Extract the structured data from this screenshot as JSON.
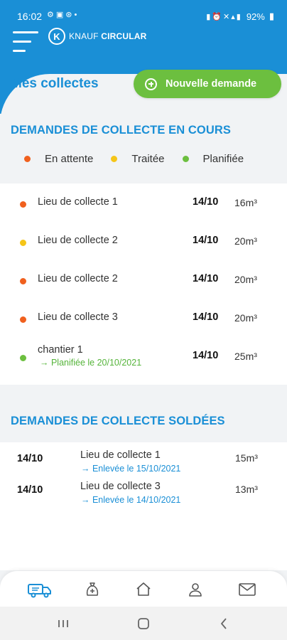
{
  "status_bar": {
    "time": "16:02",
    "battery": "92%"
  },
  "app": {
    "logo_prefix": "KNAUF",
    "logo_suffix": "CIRCULAR"
  },
  "page": {
    "title": "Mes collectes",
    "new_request_label": "Nouvelle demande"
  },
  "pending": {
    "title": "DEMANDES DE COLLECTE EN COURS",
    "legend": [
      {
        "label": "En attente",
        "color": "#f0601e"
      },
      {
        "label": "Traitée",
        "color": "#f5c518"
      },
      {
        "label": "Planifiée",
        "color": "#6cbf3f"
      }
    ],
    "items": [
      {
        "name": "Lieu de collecte 1",
        "date": "14/10",
        "volume": "16m³",
        "status_color": "#f0601e"
      },
      {
        "name": "Lieu de collecte 2",
        "date": "14/10",
        "volume": "20m³",
        "status_color": "#f5c518"
      },
      {
        "name": "Lieu de collecte 2",
        "date": "14/10",
        "volume": "20m³",
        "status_color": "#f0601e"
      },
      {
        "name": "Lieu de collecte 3",
        "date": "14/10",
        "volume": "20m³",
        "status_color": "#f0601e"
      },
      {
        "name": "chantier 1",
        "date": "14/10",
        "volume": "25m³",
        "status_color": "#6cbf3f",
        "sub": "→  Planifiée le 20/10/2021"
      }
    ]
  },
  "closed": {
    "title": "DEMANDES DE COLLECTE SOLDÉES",
    "items": [
      {
        "date": "14/10",
        "name": "Lieu de collecte 1",
        "volume": "15m³",
        "sub": "→  Enlevée le 15/10/2021"
      },
      {
        "date": "14/10",
        "name": "Lieu de collecte 3",
        "volume": "13m³",
        "sub": "→  Enlevée le 14/10/2021"
      }
    ]
  },
  "bottom_nav": {
    "items": [
      {
        "icon": "truck-icon",
        "active": true
      },
      {
        "icon": "waste-bag-icon",
        "active": false
      },
      {
        "icon": "home-icon",
        "active": false
      },
      {
        "icon": "user-icon",
        "active": false
      },
      {
        "icon": "mail-icon",
        "active": false
      }
    ]
  },
  "colors": {
    "brand_blue": "#1a8fd6",
    "brand_green": "#6cbf3f",
    "pending_orange": "#f0601e",
    "processed_yellow": "#f5c518"
  }
}
